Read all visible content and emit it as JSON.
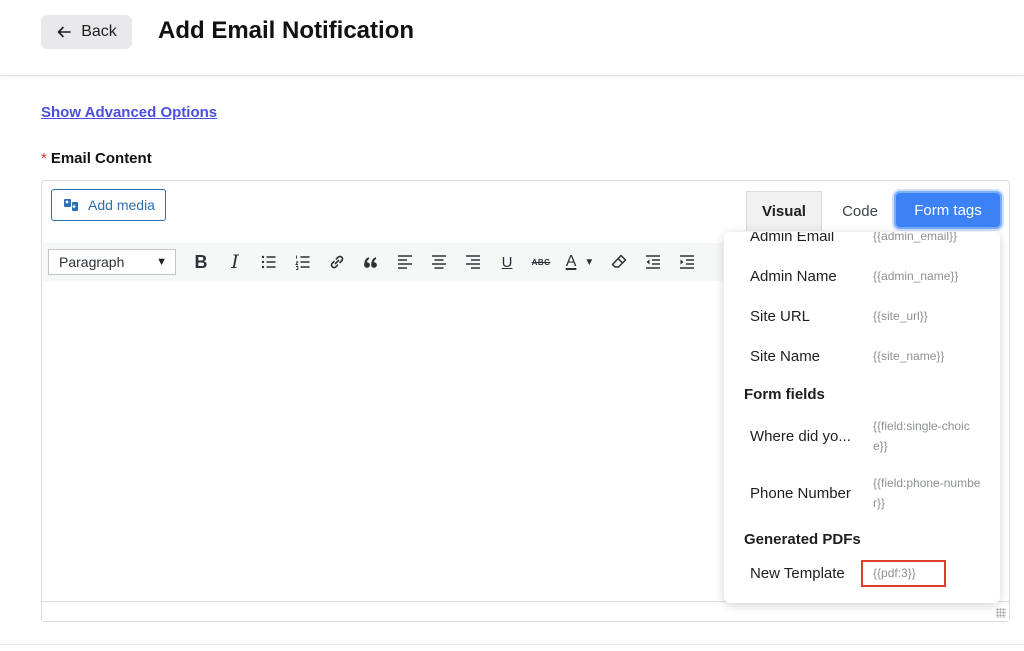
{
  "header": {
    "back_label": "Back",
    "title": "Add Email Notification"
  },
  "advanced_link": "Show Advanced Options",
  "email_content": {
    "required_mark": "*",
    "label": "Email Content"
  },
  "editor": {
    "add_media_label": "Add media",
    "tabs": {
      "visual": "Visual",
      "code": "Code",
      "form_tags": "Form tags"
    },
    "format_select": "Paragraph",
    "toolbar_icons": [
      "bold-icon",
      "italic-icon",
      "bulleted-list-icon",
      "numbered-list-icon",
      "link-icon",
      "blockquote-icon",
      "align-left-icon",
      "align-center-icon",
      "align-right-icon",
      "underline-icon",
      "strikethrough-icon",
      "text-color-icon",
      "clear-formatting-icon",
      "outdent-icon",
      "indent-icon"
    ]
  },
  "form_tags_menu": {
    "system_items": [
      {
        "name": "Admin Email",
        "tag": "{{admin_email}}"
      },
      {
        "name": "Admin Name",
        "tag": "{{admin_name}}"
      },
      {
        "name": "Site URL",
        "tag": "{{site_url}}"
      },
      {
        "name": "Site Name",
        "tag": "{{site_name}}"
      }
    ],
    "form_fields_heading": "Form fields",
    "form_fields": [
      {
        "name": "Where did yo...",
        "tag": "{{field:single-choice}}"
      },
      {
        "name": "Phone Number",
        "tag": "{{field:phone-number}}"
      }
    ],
    "pdfs_heading": "Generated PDFs",
    "pdfs": [
      {
        "name": "New Template",
        "tag": "{{pdf:3}}"
      }
    ],
    "highlight_color": "#d9402b"
  },
  "colors": {
    "accent": "#3c82f6",
    "link": "#4a4fde",
    "required": "#d63638"
  }
}
